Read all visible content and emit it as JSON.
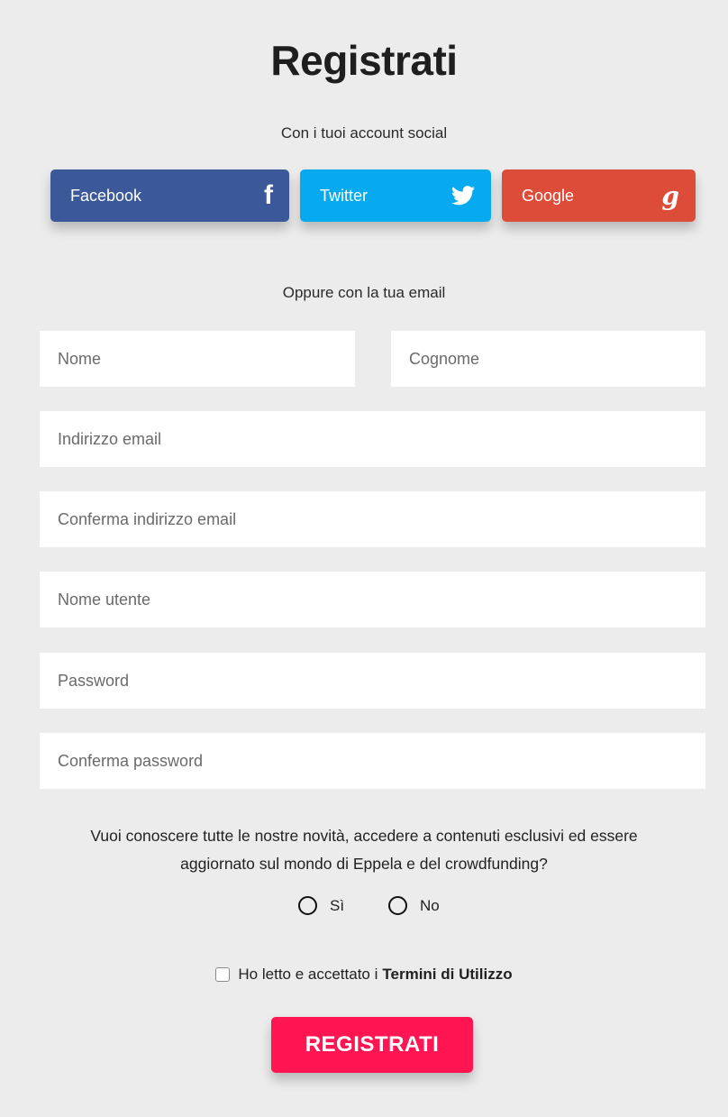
{
  "title": "Registrati",
  "social_heading": "Con i tuoi account social",
  "social": {
    "facebook": {
      "label": "Facebook",
      "icon": "f"
    },
    "twitter": {
      "label": "Twitter"
    },
    "google": {
      "label": "Google",
      "icon": "g"
    }
  },
  "email_heading": "Oppure con la tua email",
  "form": {
    "first_name": {
      "placeholder": "Nome",
      "value": ""
    },
    "last_name": {
      "placeholder": "Cognome",
      "value": ""
    },
    "email": {
      "placeholder": "Indirizzo email",
      "value": ""
    },
    "email_confirm": {
      "placeholder": "Conferma indirizzo email",
      "value": ""
    },
    "username": {
      "placeholder": "Nome utente",
      "value": ""
    },
    "password": {
      "placeholder": "Password",
      "value": ""
    },
    "password_confirm": {
      "placeholder": "Conferma password",
      "value": ""
    }
  },
  "newsletter": {
    "question_line1": "Vuoi conoscere tutte le nostre novità, accedere a contenuti esclusivi ed essere",
    "question_line2": "aggiornato sul mondo di Eppela e del crowdfunding?",
    "yes_label": "Sì",
    "no_label": "No"
  },
  "terms": {
    "prefix": "Ho letto e accettato i",
    "link": "Termini di Utilizzo"
  },
  "submit_label": "REGISTRATI",
  "colors": {
    "facebook": "#3b5998",
    "twitter": "#07aaee",
    "google": "#dd4b39",
    "submit": "#ff1552",
    "background": "#ececec"
  }
}
